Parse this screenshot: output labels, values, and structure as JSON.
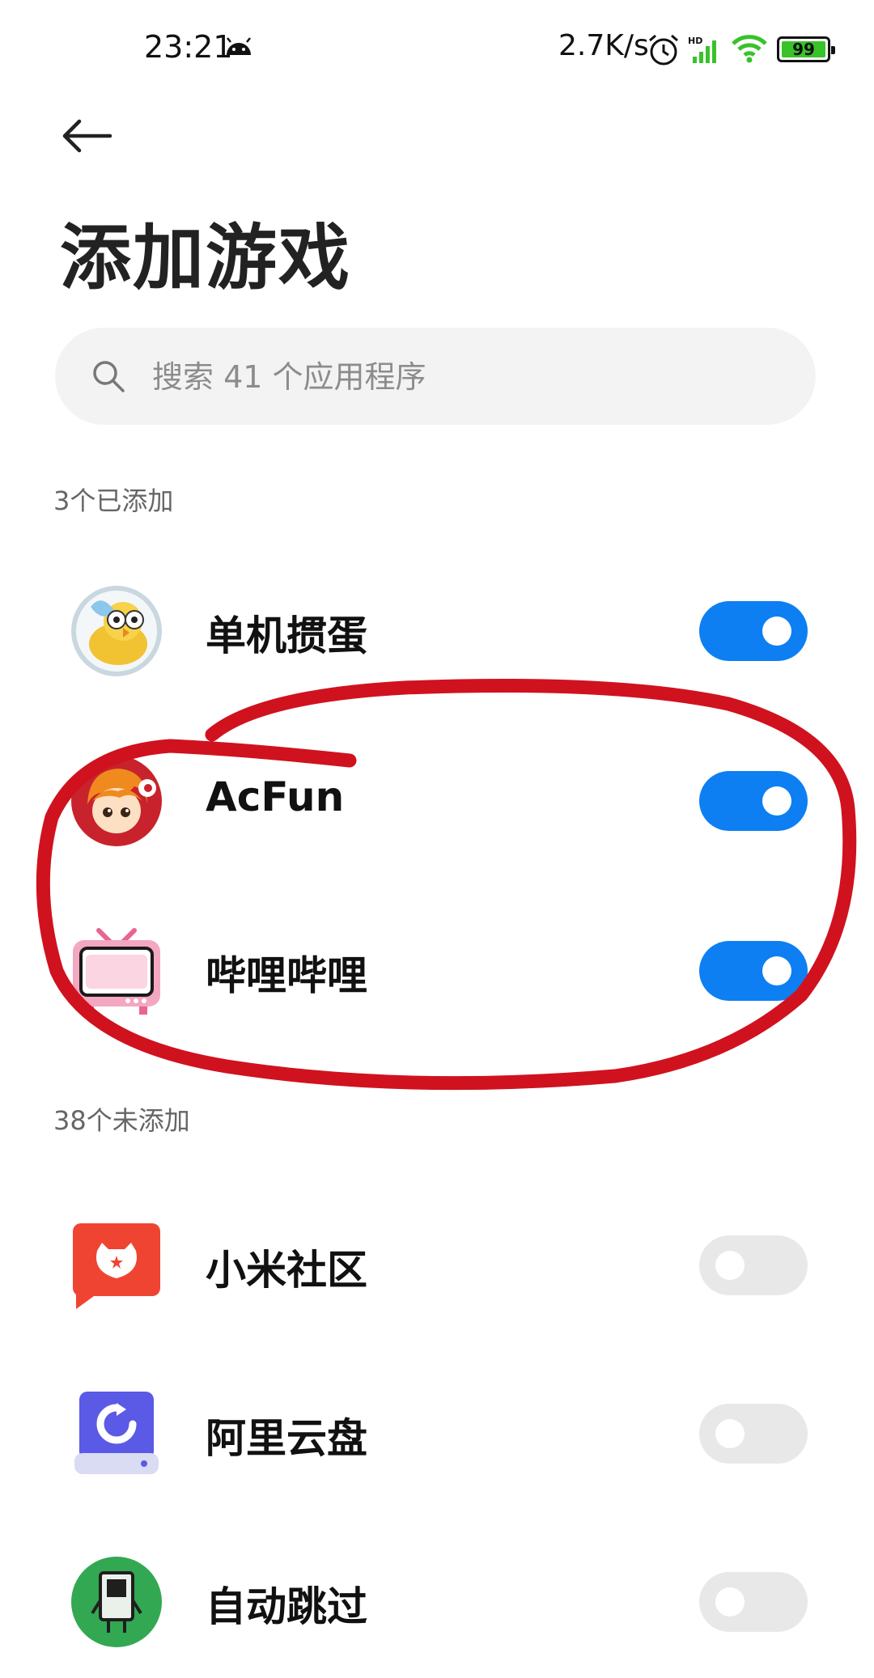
{
  "status": {
    "time": "23:21",
    "speed": "2.7K/s",
    "hd_label": "HD",
    "battery": "99",
    "icons": [
      "android-icon",
      "alarm-icon",
      "signal-icon",
      "wifi-icon",
      "battery-icon"
    ]
  },
  "header": {
    "title": "添加游戏"
  },
  "search": {
    "placeholder": "搜索 41 个应用程序"
  },
  "sections": {
    "added_label": "3个已添加",
    "not_added_label": "38个未添加"
  },
  "apps": [
    {
      "name": "单机掼蛋",
      "enabled": true
    },
    {
      "name": "AcFun",
      "enabled": true
    },
    {
      "name": "哔哩哔哩",
      "enabled": true
    },
    {
      "name": "小米社区",
      "enabled": false
    },
    {
      "name": "阿里云盘",
      "enabled": false
    },
    {
      "name": "自动跳过",
      "enabled": false
    }
  ],
  "colors": {
    "toggle_on": "#0d7ff3",
    "toggle_off": "#e8e8e8",
    "annotation": "#d0121f"
  }
}
